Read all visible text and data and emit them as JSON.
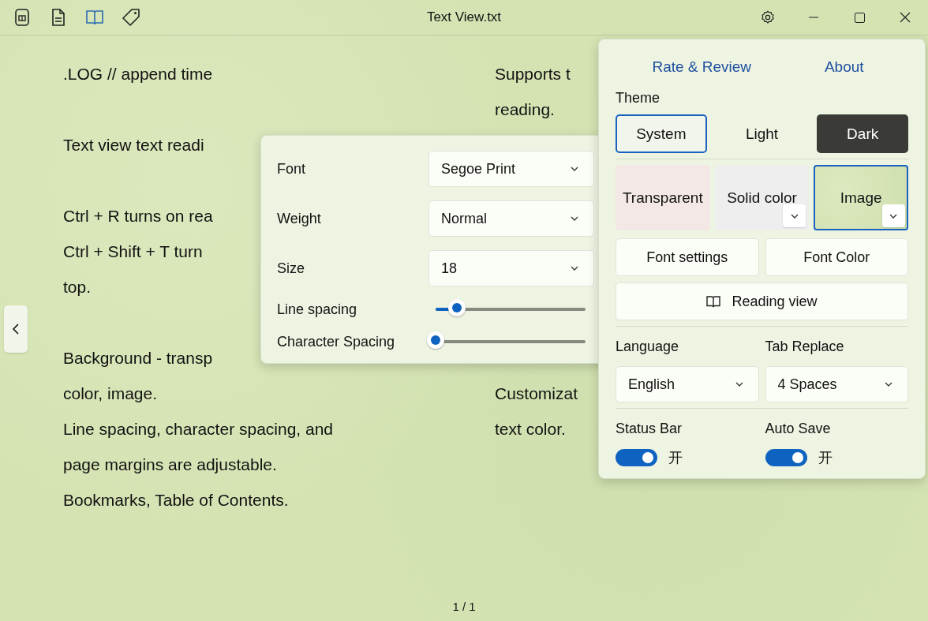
{
  "window": {
    "title": "Text View.txt"
  },
  "toolbar": [
    {
      "kind": "file",
      "selected": false
    },
    {
      "kind": "document",
      "selected": false
    },
    {
      "kind": "book",
      "selected": true
    },
    {
      "kind": "tag",
      "selected": false
    }
  ],
  "document": {
    "left_column": [
      [
        ".LOG // append time"
      ],
      [
        "Text view text readi"
      ],
      [
        "Ctrl + R turns on rea",
        "Ctrl + Shift + T turn",
        "top."
      ],
      [
        "Background - transp",
        "color, image.",
        "Line spacing, character spacing, and",
        "page margins are adjustable.",
        "Bookmarks, Table of Contents."
      ]
    ],
    "right_column": [
      [
        "Supports t",
        "reading."
      ],
      [
        "Customizat",
        "text color."
      ]
    ],
    "page_indicator": "1 / 1"
  },
  "font_popup": {
    "dropdowns": [
      {
        "label": "Font",
        "value": "Segoe Print"
      },
      {
        "label": "Weight",
        "value": "Normal"
      },
      {
        "label": "Size",
        "value": "18"
      }
    ],
    "sliders": [
      {
        "label": "Line spacing",
        "level": 0.14
      },
      {
        "label": "Character Spacing",
        "level": 0.0
      }
    ]
  },
  "settings": {
    "links": [
      "Rate & Review",
      "About"
    ],
    "theme_label": "Theme",
    "themes": [
      {
        "label": "System",
        "kind": "system",
        "selected": true
      },
      {
        "label": "Light",
        "kind": "light",
        "selected": false
      },
      {
        "label": "Dark",
        "kind": "dark",
        "selected": false
      }
    ],
    "backgrounds": [
      {
        "label": "Transparent",
        "kind": "transparent",
        "selected": false,
        "has_menu": false
      },
      {
        "label": "Solid color",
        "kind": "solid",
        "selected": false,
        "has_menu": true
      },
      {
        "label": "Image",
        "kind": "image",
        "selected": true,
        "has_menu": true
      }
    ],
    "buttons": [
      "Font settings",
      "Font Color"
    ],
    "reading_view": "Reading view",
    "selects": [
      {
        "label": "Language",
        "value": "English"
      },
      {
        "label": "Tab Replace",
        "value": "4 Spaces"
      }
    ],
    "toggles": [
      {
        "label": "Status Bar",
        "on": true,
        "state_text": "开"
      },
      {
        "label": "Auto Save",
        "on": true,
        "state_text": "开"
      }
    ]
  }
}
